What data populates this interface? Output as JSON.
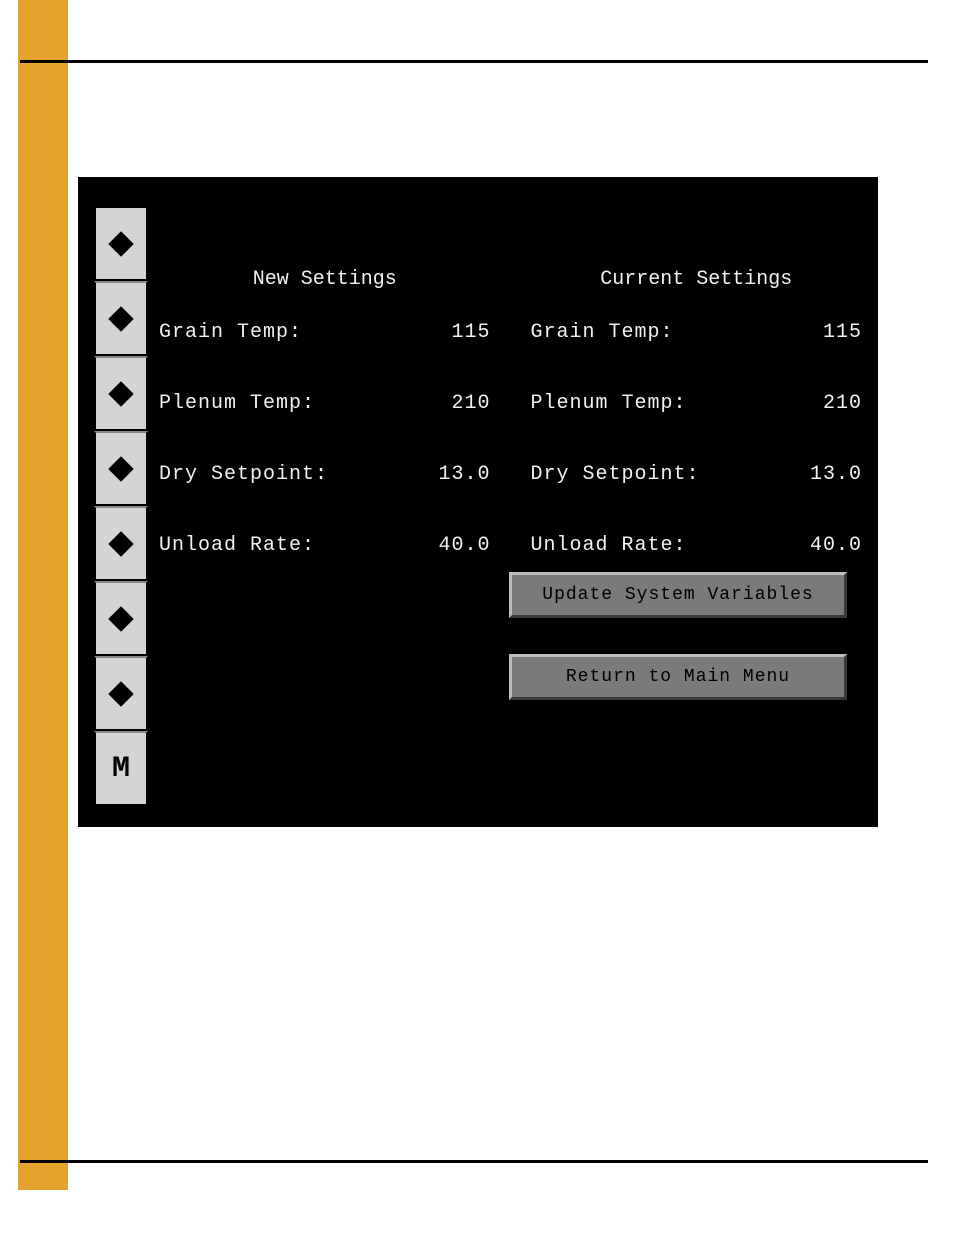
{
  "sidebar": {
    "menu_label": "M"
  },
  "settings": {
    "new": {
      "header": "New Settings",
      "grain_temp": {
        "label": "Grain Temp:",
        "value": "115"
      },
      "plenum_temp": {
        "label": "Plenum Temp:",
        "value": "210"
      },
      "dry_setpoint": {
        "label": "Dry Setpoint:",
        "value": "13.0"
      },
      "unload_rate": {
        "label": "Unload Rate:",
        "value": "40.0"
      }
    },
    "current": {
      "header": "Current Settings",
      "grain_temp": {
        "label": "Grain Temp:",
        "value": "115"
      },
      "plenum_temp": {
        "label": "Plenum Temp:",
        "value": "210"
      },
      "dry_setpoint": {
        "label": "Dry Setpoint:",
        "value": "13.0"
      },
      "unload_rate": {
        "label": "Unload Rate:",
        "value": "40.0"
      }
    }
  },
  "buttons": {
    "update": "Update System Variables",
    "return": "Return to Main Menu"
  }
}
